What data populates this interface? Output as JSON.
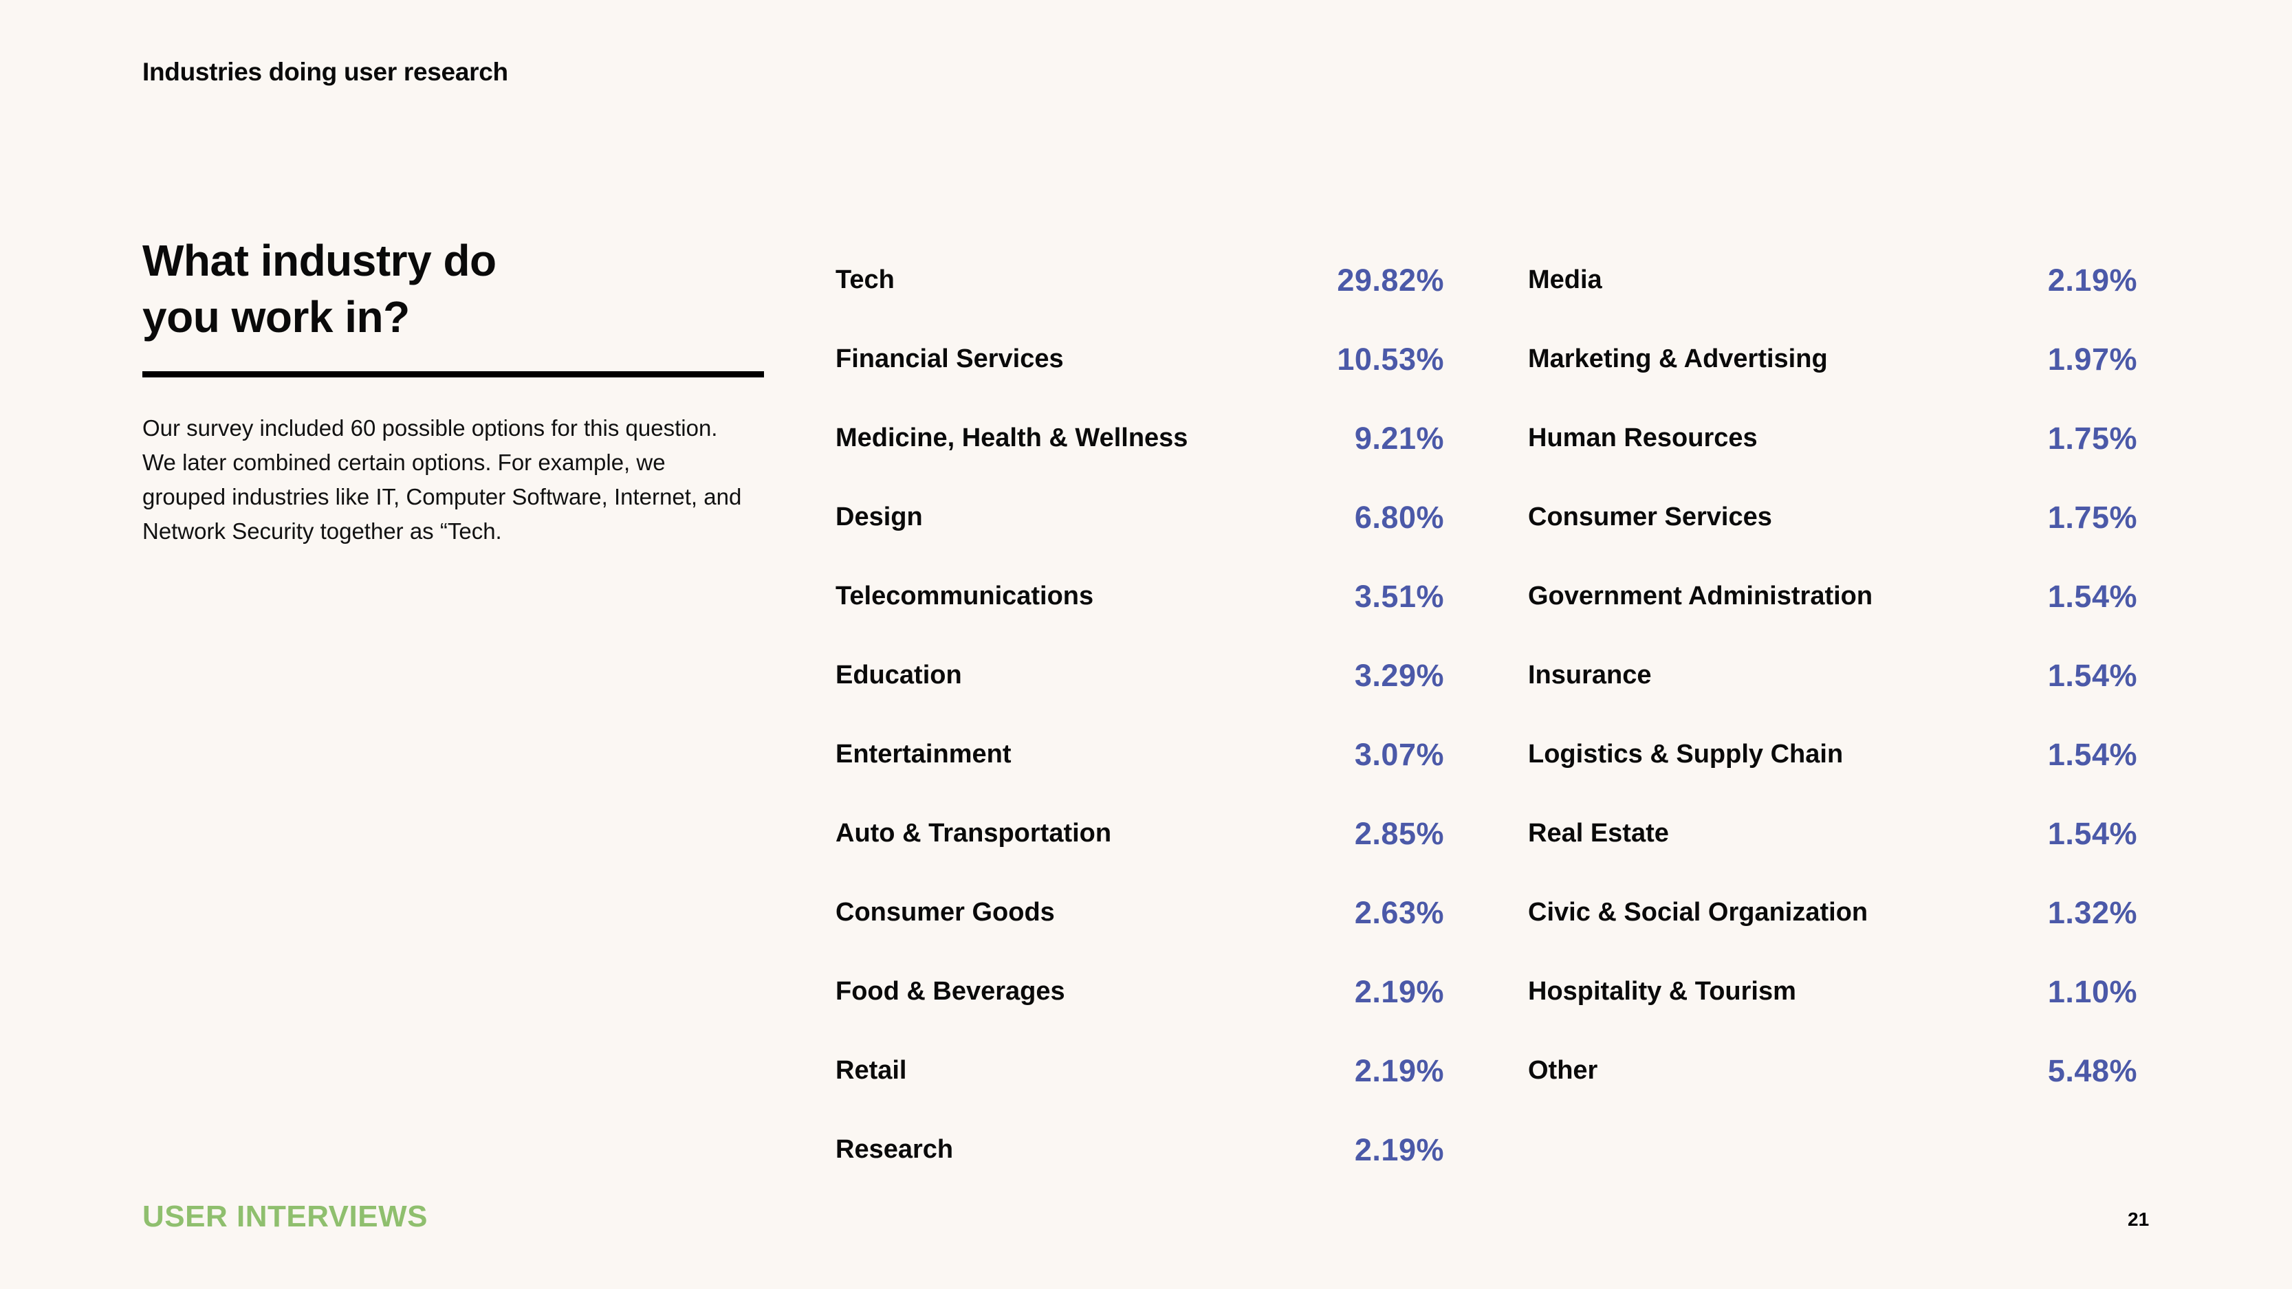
{
  "header": {
    "title": "Industries doing user research"
  },
  "question": {
    "title_line1": "What industry do",
    "title_line2": "you work in?",
    "description": "Our survey included 60 possible options for this question. We later combined certain options. For example, we grouped industries like IT, Computer Software, Internet, and Network Security together as “Tech."
  },
  "colors": {
    "accent": "#4b59a8",
    "brand": "#8fbf6e",
    "background": "#fbf7f3",
    "text": "#0a0a0a"
  },
  "columns": [
    {
      "rows": [
        {
          "label": "Tech",
          "value": "29.82%"
        },
        {
          "label": "Financial Services",
          "value": "10.53%"
        },
        {
          "label": "Medicine, Health & Wellness",
          "value": "9.21%"
        },
        {
          "label": "Design",
          "value": "6.80%"
        },
        {
          "label": "Telecommunications",
          "value": "3.51%"
        },
        {
          "label": "Education",
          "value": "3.29%"
        },
        {
          "label": "Entertainment",
          "value": "3.07%"
        },
        {
          "label": "Auto & Transportation",
          "value": "2.85%"
        },
        {
          "label": "Consumer Goods",
          "value": "2.63%"
        },
        {
          "label": "Food & Beverages",
          "value": "2.19%"
        },
        {
          "label": "Retail",
          "value": "2.19%"
        },
        {
          "label": "Research",
          "value": "2.19%"
        }
      ]
    },
    {
      "rows": [
        {
          "label": "Media",
          "value": "2.19%"
        },
        {
          "label": "Marketing & Advertising",
          "value": "1.97%"
        },
        {
          "label": "Human Resources",
          "value": "1.75%"
        },
        {
          "label": "Consumer Services",
          "value": "1.75%"
        },
        {
          "label": "Government Administration",
          "value": "1.54%"
        },
        {
          "label": "Insurance",
          "value": "1.54%"
        },
        {
          "label": "Logistics & Supply Chain",
          "value": "1.54%"
        },
        {
          "label": "Real Estate",
          "value": "1.54%"
        },
        {
          "label": "Civic & Social Organization",
          "value": "1.32%"
        },
        {
          "label": "Hospitality & Tourism",
          "value": "1.10%"
        },
        {
          "label": "Other",
          "value": "5.48%"
        }
      ]
    }
  ],
  "footer": {
    "brand": "USER INTERVIEWS",
    "page_number": "21"
  }
}
